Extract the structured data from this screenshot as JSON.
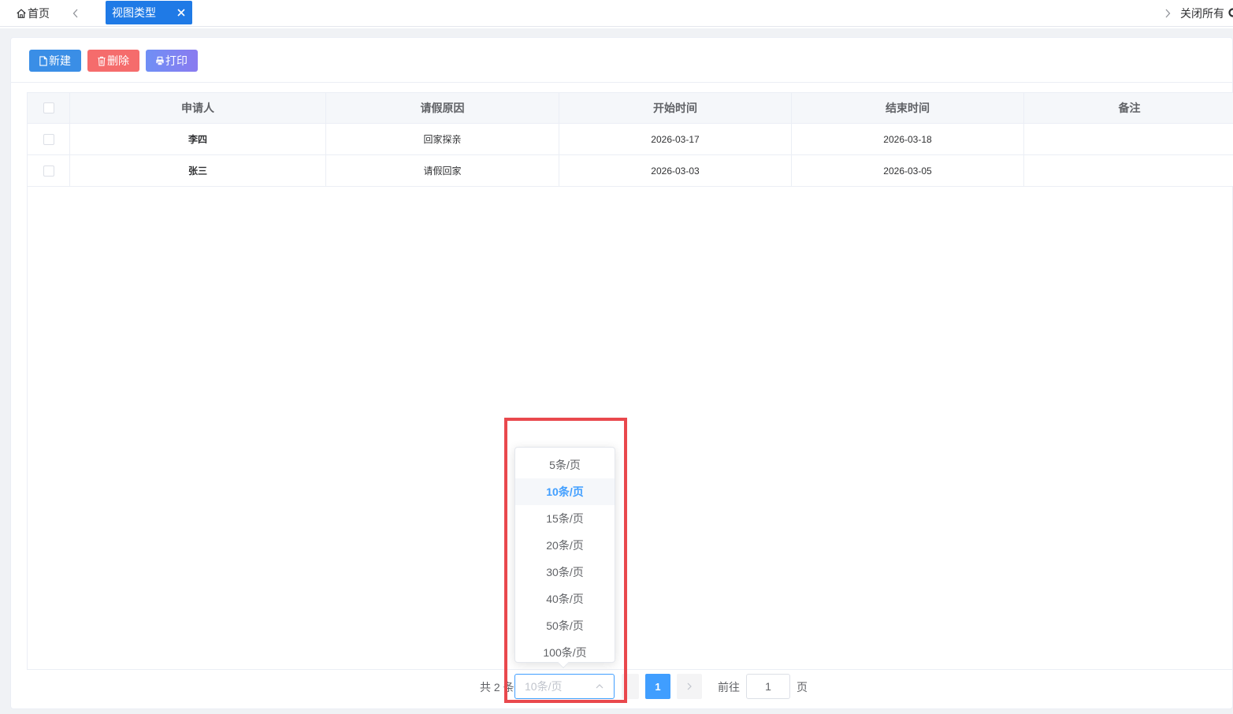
{
  "tabs": {
    "home_label": "首页",
    "active_label": "视图类型",
    "close_all_label": "关闭所有"
  },
  "toolbar": {
    "new_label": "新建",
    "delete_label": "删除",
    "print_label": "打印"
  },
  "table": {
    "headers": [
      "申请人",
      "请假原因",
      "开始时间",
      "结束时间",
      "备注"
    ],
    "rows": [
      {
        "applicant": "李四",
        "reason": "回家探亲",
        "start": "2026-03-17",
        "end": "2026-03-18",
        "note": ""
      },
      {
        "applicant": "张三",
        "reason": "请假回家",
        "start": "2026-03-03",
        "end": "2026-03-05",
        "note": ""
      }
    ]
  },
  "pagination": {
    "total_text": "共 2 条",
    "page_size_value": "10条/页",
    "current_page": "1",
    "goto_label": "前往",
    "goto_value": "1",
    "goto_unit": "页"
  },
  "page_size_options": [
    "5条/页",
    "10条/页",
    "15条/页",
    "20条/页",
    "30条/页",
    "40条/页",
    "50条/页",
    "100条/页"
  ],
  "page_size_selected_index": 1,
  "colors": {
    "primary": "#409eff",
    "tab_active": "#1f7ae6",
    "danger": "#f56c6c",
    "highlight": "#e9484d"
  }
}
